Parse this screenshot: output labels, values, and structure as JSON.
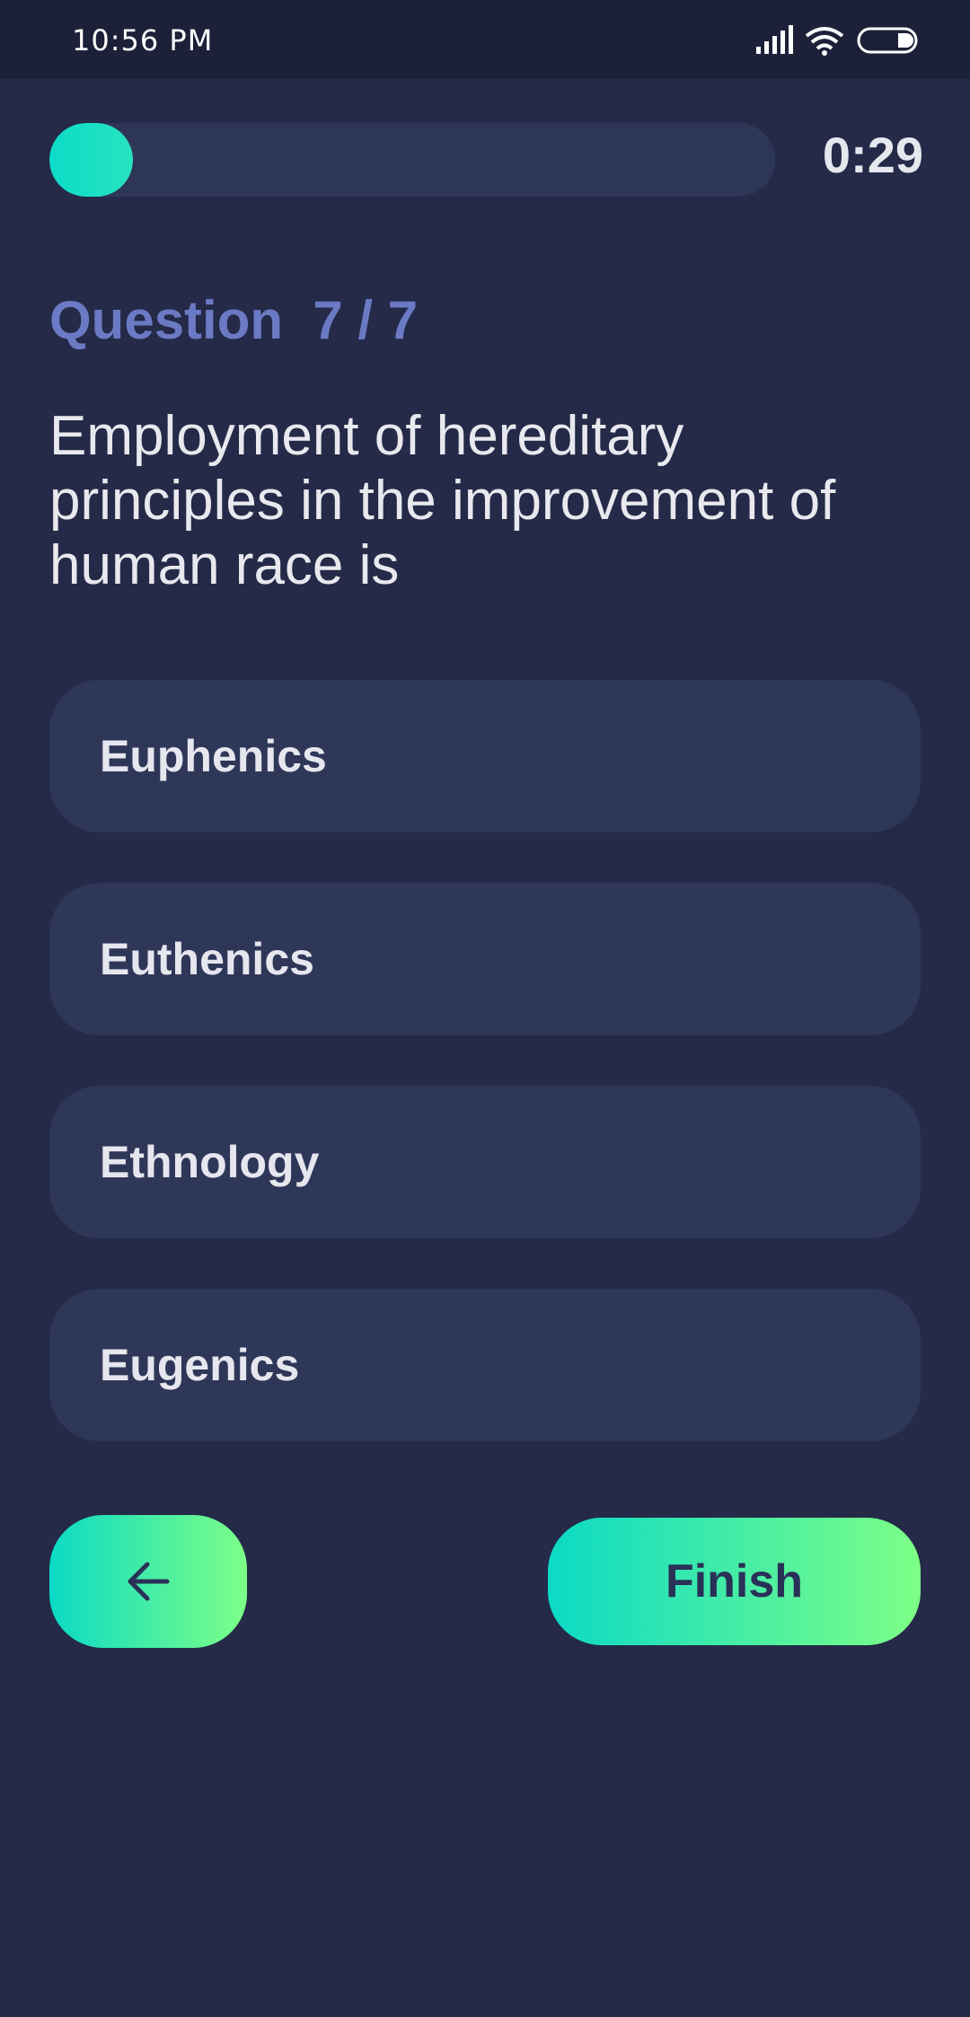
{
  "status_bar": {
    "time": "10:56 PM",
    "icons": [
      "signal-icon",
      "wifi-icon",
      "battery-icon"
    ]
  },
  "quiz": {
    "progress_fraction": 0.115,
    "timer": "0:29",
    "question_counter": "Question  7 / 7",
    "question_text": "Employment of hereditary principles in the improvement of human race is",
    "options": [
      {
        "label": "Euphenics"
      },
      {
        "label": "Euthenics"
      },
      {
        "label": "Ethnology"
      },
      {
        "label": "Eugenics"
      }
    ]
  },
  "footer": {
    "back_icon": "arrow-left-icon",
    "finish_label": "Finish"
  },
  "colors": {
    "background": "#242a47",
    "card": "#2f3759",
    "accent_start": "#0bdac6",
    "accent_end": "#7dff86",
    "counter": "#6b7ac4"
  }
}
